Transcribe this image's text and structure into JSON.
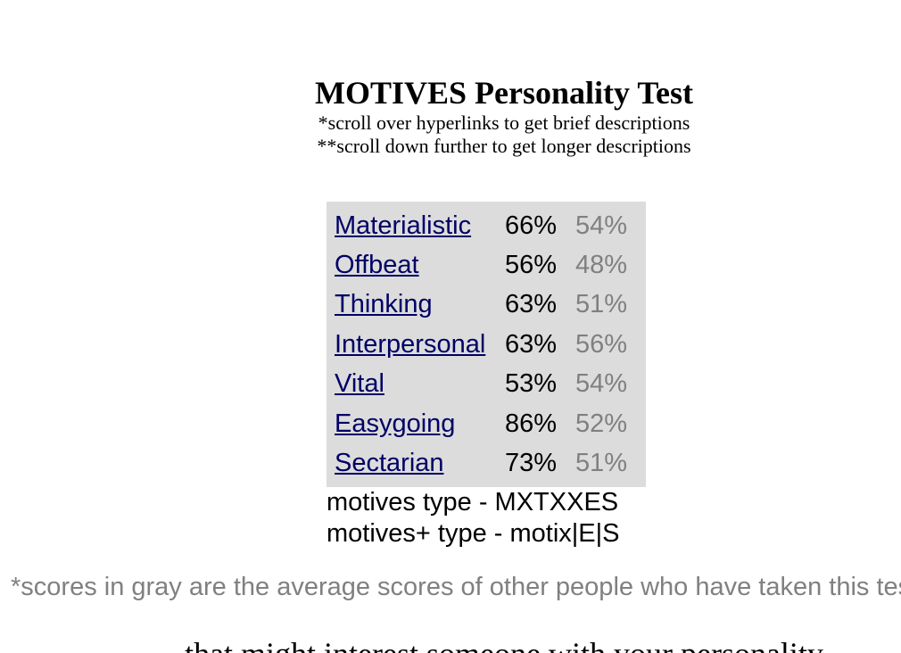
{
  "header": {
    "title": "MOTIVES Personality Test",
    "note1": "*scroll over hyperlinks to get brief descriptions",
    "note2": "**scroll down further to get longer descriptions"
  },
  "results": [
    {
      "trait": "Materialistic",
      "score": "66%",
      "average": "54%"
    },
    {
      "trait": "Offbeat",
      "score": "56%",
      "average": "48%"
    },
    {
      "trait": "Thinking",
      "score": "63%",
      "average": "51%"
    },
    {
      "trait": "Interpersonal",
      "score": "63%",
      "average": "56%"
    },
    {
      "trait": "Vital",
      "score": "53%",
      "average": "54%"
    },
    {
      "trait": "Easygoing",
      "score": "86%",
      "average": "52%"
    },
    {
      "trait": "Sectarian",
      "score": "73%",
      "average": "51%"
    }
  ],
  "types": {
    "motives_type": "motives type - MXTXXES",
    "motives_plus_type": "motives+ type - motix|E|S"
  },
  "footnote": "*scores in gray are the average scores of other people who have taken this test",
  "cutoff_text": "that might interest someone with your personality",
  "colors": {
    "link": "#000066",
    "average": "#808080",
    "panel_bg": "#dcdcdc"
  }
}
